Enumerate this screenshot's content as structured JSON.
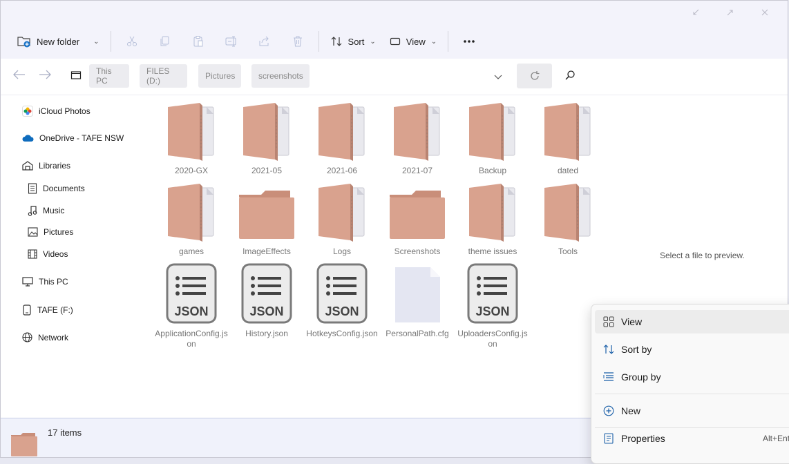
{
  "window": {
    "caption": {
      "minimize_icon": "restore-down-arrow",
      "maximize_icon": "expand-arrow",
      "close_icon": "close"
    }
  },
  "toolbar": {
    "new_folder_label": "New folder",
    "sort_label": "Sort",
    "view_label": "View"
  },
  "address": {
    "crumbs": [
      "This PC",
      "FILES (D:)",
      "Pictures",
      "screenshots"
    ]
  },
  "sidebar": {
    "items": [
      {
        "label": "iCloud Photos",
        "icon": "icloud-photos-icon"
      },
      {
        "label": "OneDrive - TAFE NSW",
        "icon": "onedrive-icon"
      },
      {
        "label": "Libraries",
        "icon": "libraries-icon"
      },
      {
        "label": "Documents",
        "icon": "documents-icon"
      },
      {
        "label": "Music",
        "icon": "music-icon"
      },
      {
        "label": "Pictures",
        "icon": "pictures-icon"
      },
      {
        "label": "Videos",
        "icon": "videos-icon"
      },
      {
        "label": "This PC",
        "icon": "pc-icon"
      },
      {
        "label": "TAFE (F:)",
        "icon": "drive-icon"
      },
      {
        "label": "Network",
        "icon": "network-icon"
      }
    ]
  },
  "files": [
    {
      "name": "2020-GX",
      "type": "folder-zip"
    },
    {
      "name": "2021-05",
      "type": "folder-zip"
    },
    {
      "name": "2021-06",
      "type": "folder-zip"
    },
    {
      "name": "2021-07",
      "type": "folder-zip"
    },
    {
      "name": "Backup",
      "type": "folder-zip"
    },
    {
      "name": "dated",
      "type": "folder-zip"
    },
    {
      "name": "games",
      "type": "folder-zip"
    },
    {
      "name": "ImageEffects",
      "type": "folder"
    },
    {
      "name": "Logs",
      "type": "folder-zip"
    },
    {
      "name": "Screenshots",
      "type": "folder"
    },
    {
      "name": "theme issues",
      "type": "folder-zip"
    },
    {
      "name": "Tools",
      "type": "folder-zip"
    },
    {
      "name": "ApplicationConfig.json",
      "type": "json",
      "badge": "JSON"
    },
    {
      "name": "History.json",
      "type": "json",
      "badge": "JSON"
    },
    {
      "name": "HotkeysConfig.json",
      "type": "json",
      "badge": "JSON"
    },
    {
      "name": "PersonalPath.cfg",
      "type": "blank"
    },
    {
      "name": "UploadersConfig.json",
      "type": "json",
      "badge": "JSON"
    }
  ],
  "preview": {
    "message": "Select a file to preview."
  },
  "status": {
    "item_count": "17 items"
  },
  "context_menu": {
    "items": [
      {
        "label": "View",
        "icon": "grid-icon"
      },
      {
        "label": "Sort by",
        "icon": "sort-icon"
      },
      {
        "label": "Group by",
        "icon": "group-icon"
      },
      {
        "label": "New",
        "icon": "plus-circle-icon"
      },
      {
        "label": "Properties",
        "icon": "properties-icon",
        "shortcut": "Alt+Ente"
      }
    ]
  },
  "colors": {
    "folder": "#d9a28e",
    "folder_dark": "#c98e79",
    "accent": "#1a73c8"
  }
}
